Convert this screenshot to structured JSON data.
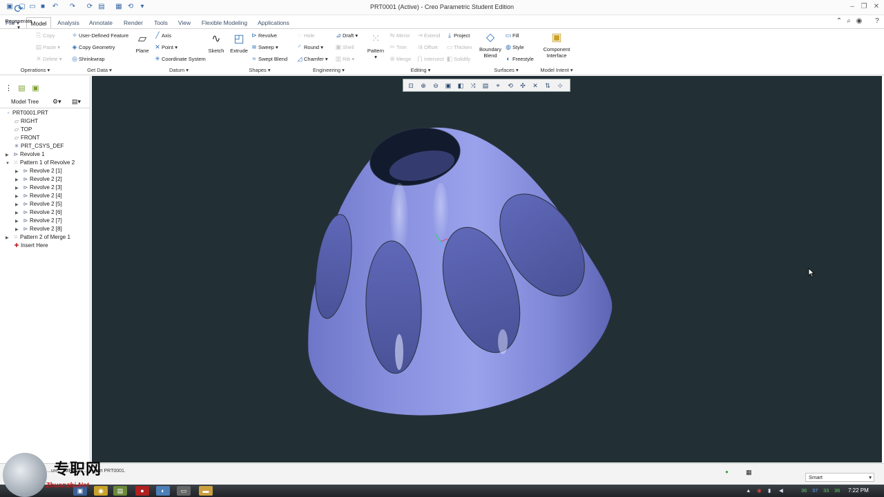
{
  "window": {
    "title": "PRT0001 (Active) - Creo Parametric Student Edition"
  },
  "tabs": [
    "File",
    "Model",
    "Analysis",
    "Annotate",
    "Render",
    "Tools",
    "View",
    "Flexible Modeling",
    "Applications"
  ],
  "ribbon": {
    "regenerate": "Regenerate",
    "copy": "Copy",
    "paste": "Paste",
    "delete": "Delete",
    "user_defined_feature": "User-Defined Feature",
    "copy_geometry": "Copy Geometry",
    "shrinkwrap": "Shrinkwrap",
    "plane": "Plane",
    "axis": "Axis",
    "point": "Point",
    "coordinate_system": "Coordinate System",
    "sketch": "Sketch",
    "extrude": "Extrude",
    "revolve": "Revolve",
    "sweep": "Sweep",
    "swept_blend": "Swept Blend",
    "hole": "Hole",
    "round": "Round",
    "chamfer": "Chamfer",
    "draft": "Draft",
    "shell": "Shell",
    "rib": "Rib",
    "pattern": "Pattern",
    "mirror": "Mirror",
    "trim": "Trim",
    "merge": "Merge",
    "extend": "Extend",
    "offset": "Offset",
    "intersect": "Intersect",
    "project": "Project",
    "thicken": "Thicken",
    "solidify": "Solidify",
    "boundary_blend_1": "Boundary",
    "boundary_blend_2": "Blend",
    "fill": "Fill",
    "style": "Style",
    "freestyle": "Freestyle",
    "component_interface_1": "Component",
    "component_interface_2": "Interface"
  },
  "groups": [
    "Operations",
    "Get Data",
    "Datum",
    "Shapes",
    "Engineering",
    "Editing",
    "Surfaces",
    "Model Intent"
  ],
  "model_tree": {
    "label": "Model Tree",
    "items": [
      "PRT0001.PRT",
      "RIGHT",
      "TOP",
      "FRONT",
      "PRT_CSYS_DEF",
      "Revolve 1",
      "Pattern 1 of Revolve 2",
      "Revolve 2 [1]",
      "Revolve 2 [2]",
      "Revolve 2 [3]",
      "Revolve 2 [4]",
      "Revolve 2 [5]",
      "Revolve 2 [6]",
      "Revolve 2 [7]",
      "Revolve 2 [8]",
      "Pattern 2 of Merge 1",
      "Insert Here"
    ]
  },
  "status": {
    "message": "...ure ... MERGE ... in part PRT0001.",
    "filter": "Smart"
  },
  "taskbar": {
    "clock": "7:22 PM",
    "tray_numbers": [
      "36",
      "37",
      "33",
      "36"
    ]
  },
  "watermark": {
    "chinese": "专职网",
    "latin": "Zhuanzhi.Net"
  },
  "colors": {
    "viewport_bg": "#223035",
    "model_surface": "#7e86d8",
    "ribbon_accent": "#2f6fb5"
  }
}
